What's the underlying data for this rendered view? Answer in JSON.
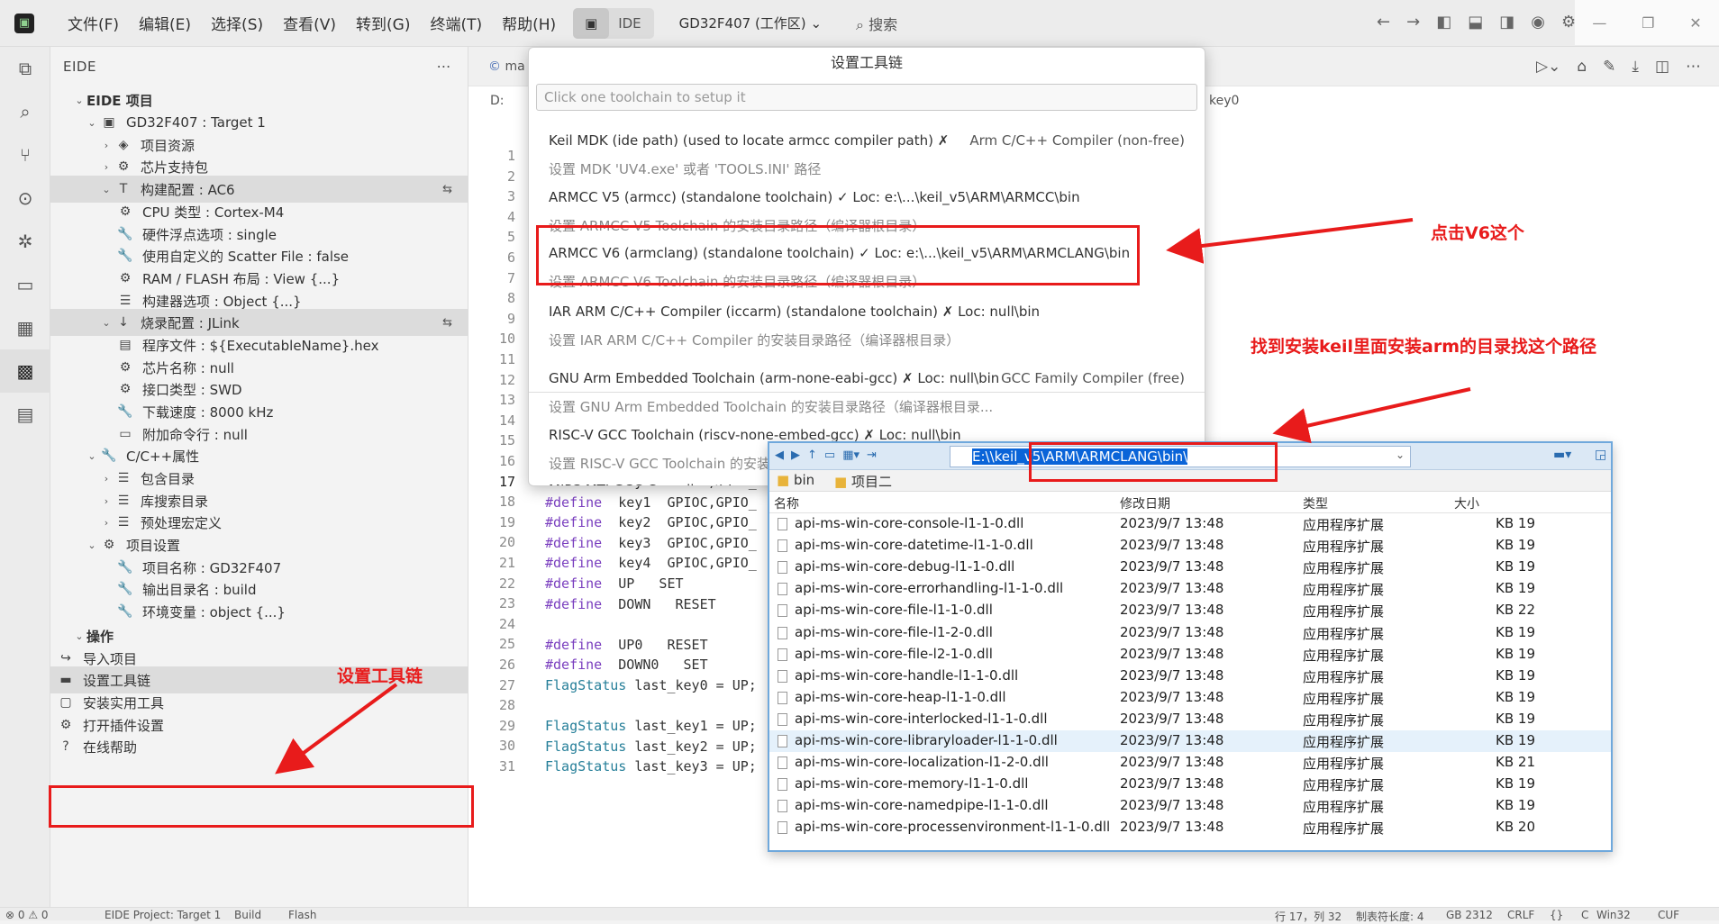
{
  "titlebar": {
    "menu": [
      "文件(F)",
      "编辑(E)",
      "选择(S)",
      "查看(V)",
      "转到(G)",
      "终端(T)",
      "帮助(H)"
    ],
    "ide_label": "IDE",
    "workspace": "GD32F407 (工作区)",
    "search_label": "搜索"
  },
  "sidebar": {
    "title": "EIDE",
    "section_project": "EIDE 项目",
    "items": [
      {
        "label": "GD32F407 : Target 1"
      },
      {
        "label": "项目资源"
      },
      {
        "label": "芯片支持包"
      },
      {
        "label": "构建配置 : AC6"
      },
      {
        "label": "CPU 类型 : Cortex-M4"
      },
      {
        "label": "硬件浮点选项 : single"
      },
      {
        "label": "使用自定义的 Scatter File : false"
      },
      {
        "label": "RAM / FLASH 布局 : View {...}"
      },
      {
        "label": "构建器选项 : Object {...}"
      },
      {
        "label": "烧录配置 : JLink"
      },
      {
        "label": "程序文件 : ${ExecutableName}.hex"
      },
      {
        "label": "芯片名称 : null"
      },
      {
        "label": "接口类型 : SWD"
      },
      {
        "label": "下载速度 : 8000 kHz"
      },
      {
        "label": "附加命令行 : null"
      },
      {
        "label": "C/C++属性"
      },
      {
        "label": "包含目录"
      },
      {
        "label": "库搜索目录"
      },
      {
        "label": "预处理宏定义"
      },
      {
        "label": "项目设置"
      },
      {
        "label": "项目名称 : GD32F407"
      },
      {
        "label": "输出目录名 : build"
      },
      {
        "label": "环境变量 : object {...}"
      }
    ],
    "section_ops": "操作",
    "ops": [
      {
        "label": "导入项目"
      },
      {
        "label": "设置工具链"
      },
      {
        "label": "安装实用工具"
      },
      {
        "label": "打开插件设置"
      },
      {
        "label": "在线帮助"
      }
    ]
  },
  "editor": {
    "tab_label": "ma",
    "breadcrumb_drive": "D:",
    "breadcrumb_symbol": "key0",
    "line_numbers": [
      "1",
      "2",
      "3",
      "4",
      "5",
      "6",
      "7",
      "8",
      "9",
      "10",
      "11",
      "12",
      "13",
      "14",
      "15",
      "16",
      "17",
      "18",
      "19",
      "20",
      "21",
      "22",
      "23",
      "24",
      "25",
      "26",
      "27",
      "28",
      "29",
      "30",
      "31"
    ],
    "code": [
      {
        "kw": "#define",
        "rest": "  key0  GPIOA,GPIO_"
      },
      {
        "kw": "#define",
        "rest": "  key1  GPIOC,GPIO_"
      },
      {
        "kw": "#define",
        "rest": "  key2  GPIOC,GPIO_"
      },
      {
        "kw": "#define",
        "rest": "  key3  GPIOC,GPIO_"
      },
      {
        "kw": "#define",
        "rest": "  key4  GPIOC,GPIO_"
      },
      {
        "kw": "#define",
        "rest": "  UP   SET"
      },
      {
        "kw": "#define",
        "rest": "  DOWN   RESET"
      },
      {
        "kw": "",
        "rest": ""
      },
      {
        "kw": "#define",
        "rest": "  UP0   RESET"
      },
      {
        "kw": "#define",
        "rest": "  DOWN0   SET"
      },
      {
        "kw": "FlagStatus",
        "rest": " last_key0 = UP;"
      },
      {
        "kw": "",
        "rest": ""
      },
      {
        "kw": "FlagStatus",
        "rest": " last_key1 = UP;"
      },
      {
        "kw": "FlagStatus",
        "rest": " last_key2 = UP;"
      },
      {
        "kw": "FlagStatus",
        "rest": " last_key3 = UP;"
      }
    ]
  },
  "picker": {
    "title": "设置工具链",
    "placeholder": "Click one toolchain to setup it",
    "options": [
      {
        "name": "Keil MDK (ide path) (used to locate armcc compiler path)  ✗",
        "right": "Arm C/C++ Compiler (non-free)",
        "desc": "设置 MDK 'UV4.exe' 或者 'TOOLS.INI' 路径"
      },
      {
        "name": "ARMCC V5 (armcc) (standalone toolchain)  ✓ Loc: e:\\...\\keil_v5\\ARM\\ARMCC\\bin",
        "right": "",
        "desc": "设置 ARMCC V5 Toolchain 的安装目录路径（编译器根目录）"
      },
      {
        "name": "ARMCC V6 (armclang) (standalone toolchain)  ✓ Loc: e:\\...\\keil_v5\\ARM\\ARMCLANG\\bin",
        "right": "",
        "desc": "设置 ARMCC V6 Toolchain 的安装目录路径（编译器根目录）"
      },
      {
        "name": "IAR ARM C/C++ Compiler (iccarm) (standalone toolchain)  ✗ Loc: null\\bin",
        "right": "",
        "desc": "设置 IAR ARM C/C++ Compiler 的安装目录路径（编译器根目录）"
      },
      {
        "name": "GNU Arm Embedded Toolchain (arm-none-eabi-gcc)  ✗ Loc: null\\bin",
        "right": "GCC Family Compiler (free)",
        "desc": "设置 GNU Arm Embedded Toolchain 的安装目录路径（编译器根目录..."
      },
      {
        "name": "RISC-V GCC Toolchain (riscv-none-embed-gcc)  ✗ Loc: null\\bin",
        "right": "",
        "desc": "设置 RISC-V GCC Toolchain 的安装"
      },
      {
        "name": "MIPS MTI GCC Compiler  ✗ Loc: nu",
        "right": "",
        "desc": ""
      }
    ]
  },
  "explorer": {
    "path_prefix": "E:\\",
    "path_main": "\\keil_v5\\ARM\\ARMCLANG\\bin\\",
    "tabs": [
      "bin",
      "项目二"
    ],
    "columns": [
      "名称",
      "修改日期",
      "类型",
      "大小"
    ],
    "files": [
      {
        "name": "api-ms-win-core-console-l1-1-0.dll",
        "date": "2023/9/7 13:48",
        "type": "应用程序扩展",
        "size": "19 KB"
      },
      {
        "name": "api-ms-win-core-datetime-l1-1-0.dll",
        "date": "2023/9/7 13:48",
        "type": "应用程序扩展",
        "size": "19 KB"
      },
      {
        "name": "api-ms-win-core-debug-l1-1-0.dll",
        "date": "2023/9/7 13:48",
        "type": "应用程序扩展",
        "size": "19 KB"
      },
      {
        "name": "api-ms-win-core-errorhandling-l1-1-0.dll",
        "date": "2023/9/7 13:48",
        "type": "应用程序扩展",
        "size": "19 KB"
      },
      {
        "name": "api-ms-win-core-file-l1-1-0.dll",
        "date": "2023/9/7 13:48",
        "type": "应用程序扩展",
        "size": "22 KB"
      },
      {
        "name": "api-ms-win-core-file-l1-2-0.dll",
        "date": "2023/9/7 13:48",
        "type": "应用程序扩展",
        "size": "19 KB"
      },
      {
        "name": "api-ms-win-core-file-l2-1-0.dll",
        "date": "2023/9/7 13:48",
        "type": "应用程序扩展",
        "size": "19 KB"
      },
      {
        "name": "api-ms-win-core-handle-l1-1-0.dll",
        "date": "2023/9/7 13:48",
        "type": "应用程序扩展",
        "size": "19 KB"
      },
      {
        "name": "api-ms-win-core-heap-l1-1-0.dll",
        "date": "2023/9/7 13:48",
        "type": "应用程序扩展",
        "size": "19 KB"
      },
      {
        "name": "api-ms-win-core-interlocked-l1-1-0.dll",
        "date": "2023/9/7 13:48",
        "type": "应用程序扩展",
        "size": "19 KB"
      },
      {
        "name": "api-ms-win-core-libraryloader-l1-1-0.dll",
        "date": "2023/9/7 13:48",
        "type": "应用程序扩展",
        "size": "19 KB"
      },
      {
        "name": "api-ms-win-core-localization-l1-2-0.dll",
        "date": "2023/9/7 13:48",
        "type": "应用程序扩展",
        "size": "21 KB"
      },
      {
        "name": "api-ms-win-core-memory-l1-1-0.dll",
        "date": "2023/9/7 13:48",
        "type": "应用程序扩展",
        "size": "19 KB"
      },
      {
        "name": "api-ms-win-core-namedpipe-l1-1-0.dll",
        "date": "2023/9/7 13:48",
        "type": "应用程序扩展",
        "size": "19 KB"
      },
      {
        "name": "api-ms-win-core-processenvironment-l1-1-0.dll",
        "date": "2023/9/7 13:48",
        "type": "应用程序扩展",
        "size": "20 KB"
      }
    ]
  },
  "annotations": {
    "click_v6": "点击V6这个",
    "find_path": "找到安装keil里面安装arm的目录找这个路径",
    "set_toolchain": "设置工具链"
  },
  "statusbar": {
    "problems": "⊗ 0 ⚠ 0",
    "project": "EIDE Project: Target 1",
    "build": "Build",
    "flash": "Flash",
    "position": "行 17，列 32",
    "indent": "制表符长度: 4",
    "encoding": "GB 2312",
    "eol": "CRLF",
    "braces": "{}",
    "lang": "C",
    "platform": "Win32",
    "cuf": "CUF"
  },
  "colors": {
    "annotation": "#e81b1b",
    "selection": "#0a64d8"
  }
}
